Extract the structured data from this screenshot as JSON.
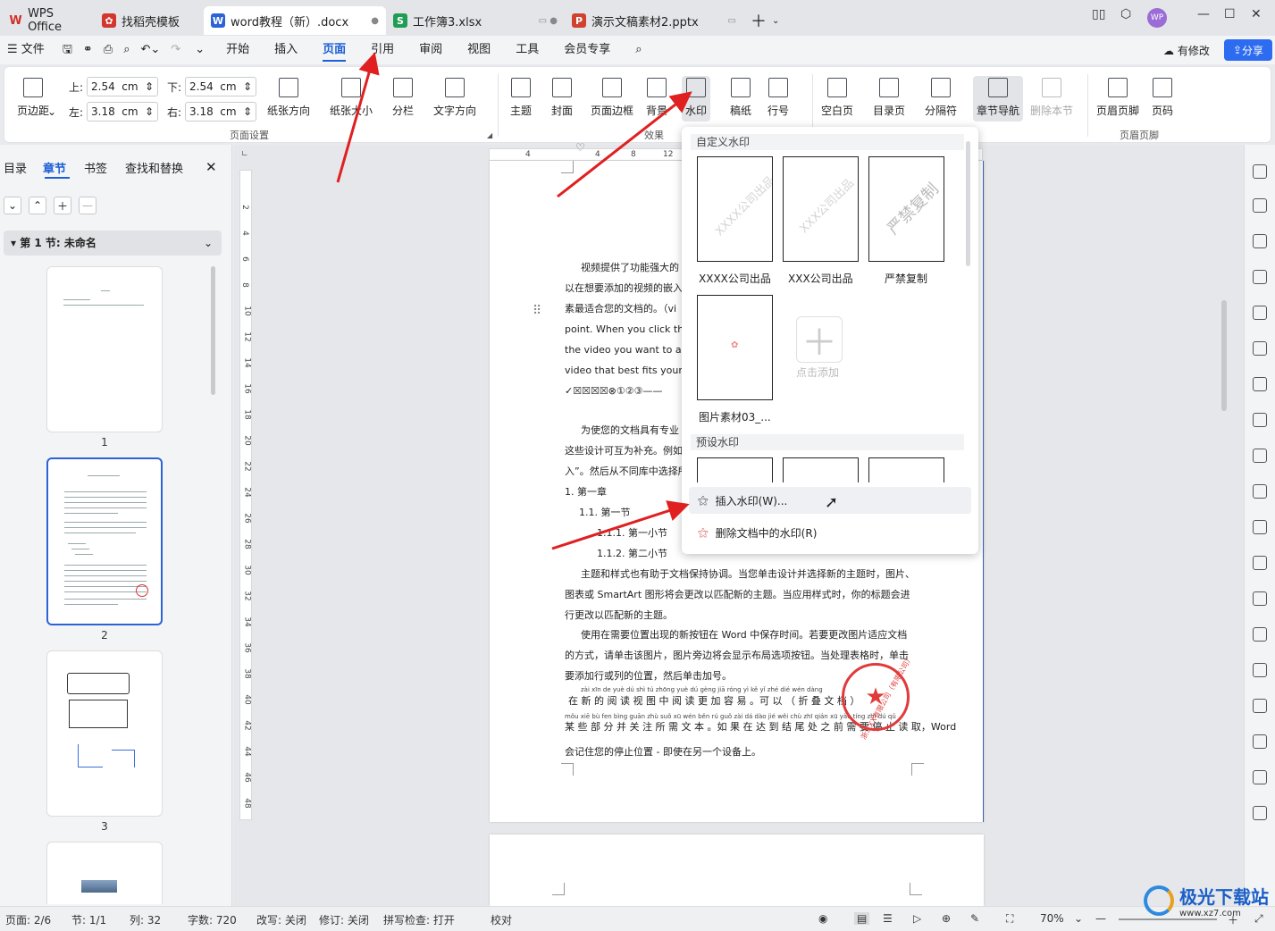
{
  "tabs": [
    {
      "label": "WPS Office",
      "icon": "wps-logo-icon"
    },
    {
      "label": "找稻壳模板",
      "icon": "docer-icon"
    },
    {
      "label": "word教程（新）.docx",
      "icon": "word-icon",
      "active": true
    },
    {
      "label": "工作簿3.xlsx",
      "icon": "sheet-icon"
    },
    {
      "label": "演示文稿素材2.pptx",
      "icon": "ppt-icon"
    }
  ],
  "avatar": "WP",
  "menu": {
    "file": "文件",
    "items": [
      "开始",
      "插入",
      "页面",
      "引用",
      "审阅",
      "视图",
      "工具",
      "会员专享"
    ],
    "active": "页面",
    "modified": "有修改",
    "share": "分享"
  },
  "ribbon": {
    "margins_btn": "页边距",
    "top_label": "上:",
    "top_value": "2.54",
    "bottom_label": "下:",
    "bottom_value": "2.54",
    "left_label": "左:",
    "left_value": "3.18",
    "right_label": "右:",
    "right_value": "3.18",
    "unit": "cm",
    "orientation": "纸张方向",
    "size": "纸张大小",
    "columns": "分栏",
    "text_dir": "文字方向",
    "page_setup_group": "页面设置",
    "theme": "主题",
    "cover": "封面",
    "border": "页面边框",
    "background": "背景",
    "watermark": "水印",
    "manuscript": "稿纸",
    "line_no": "行号",
    "effects_group": "效果",
    "blank_page": "空白页",
    "toc_page": "目录页",
    "separator": "分隔符",
    "chapter_nav": "章节导航",
    "delete_section": "删除本节",
    "header_footer": "页眉页脚",
    "page_no": "页码",
    "header_footer_group": "页眉页脚"
  },
  "leftpanel": {
    "tabs": [
      "目录",
      "章节",
      "书签",
      "查找和替换"
    ],
    "active": "章节",
    "section": "第 1 节: 未命名",
    "pages": [
      "1",
      "2",
      "3"
    ]
  },
  "ruler": {
    "h": [
      "4",
      "4",
      "8",
      "12"
    ],
    "v": [
      "2",
      "4",
      "6",
      "8",
      "10",
      "12",
      "14",
      "16",
      "18",
      "20",
      "22",
      "24",
      "26",
      "28",
      "30",
      "32",
      "34",
      "36",
      "38",
      "40",
      "42",
      "44",
      "46",
      "48"
    ]
  },
  "document": {
    "p1": [
      "视频提供了功能强大的",
      "以在想要添加的视频的嵌入",
      "素最适合您的文档的。（vi",
      "point. When you click the o",
      "the video you want to add.",
      "video that best fits your doc",
      "✓☒☒☒☒⊗①②③——"
    ],
    "p2": [
      "为使您的文档具有专业",
      "这些设计可互为补充。例如",
      "入”。然后从不同库中选择所"
    ],
    "h1": "1.  第一章",
    "h2": "1.1. 第一节",
    "h3a": "1.1.1.   第一小节",
    "h3b": "1.1.2.   第二小节",
    "p3": [
      "主题和样式也有助于文档保持协调。当您单击设计并选择新的主题时，图片、",
      "图表或 SmartArt 图形将会更改以匹配新的主题。当应用样式时，你的标题会进",
      "行更改以匹配新的主题。"
    ],
    "p4": [
      "使用在需要位置出现的新按钮在 Word 中保存时间。若要更改图片适应文档",
      "的方式，请单击该图片，图片旁边将会显示布局选项按钮。当处理表格时，单击",
      "要添加行或列的位置，然后单击加号。"
    ],
    "pinyin1": "zài xīn de yuè dú shì tú zhōng yuè dú gèng jiā róng yì   kě yǐ   zhé dié wén dàng",
    "p5": "在 新 的 阅 读 视 图 中 阅 读 更 加 容 易 。可 以 （ 折 叠 文 档 ）",
    "pinyin2": "mǒu xiē bù fen bìng guān zhù suǒ xū wén běn  rú guǒ zài dá dào jié wěi chù zhī qián xū yào tíng zhǐ dú qǔ",
    "p6": "某 些 部 分 并 关 注 所 需 文 本 。如 果 在 达 到 结 尾 处 之 前 需 要 停 止 读 取，Word",
    "p7": "会记住您的停止位置 - 即使在另一个设备上。",
    "seal": "浙江XX有限公司（有限公司）"
  },
  "dropdown": {
    "custom_title": "自定义水印",
    "custom": [
      {
        "label": "XXXX公司出品",
        "text": "XXXX公司出品"
      },
      {
        "label": "XXX公司出品",
        "text": "XXX公司出品"
      },
      {
        "label": "严禁复制",
        "text": "严禁复制"
      },
      {
        "label": "图片素材03_...",
        "text": ""
      }
    ],
    "add_label": "点击添加",
    "preset_title": "预设水印",
    "insert": "插入水印(W)...",
    "delete": "删除文档中的水印(R)"
  },
  "status": {
    "page": "页面: 2/6",
    "section": "节: 1/1",
    "col": "列: 32",
    "words": "字数: 720",
    "overwrite": "改写: 关闭",
    "revise": "修订: 关闭",
    "spell": "拼写检查: 打开",
    "proof": "校对",
    "zoom": "70%"
  },
  "watermark_site": {
    "name": "极光下载站",
    "url": "www.xz7.com"
  }
}
